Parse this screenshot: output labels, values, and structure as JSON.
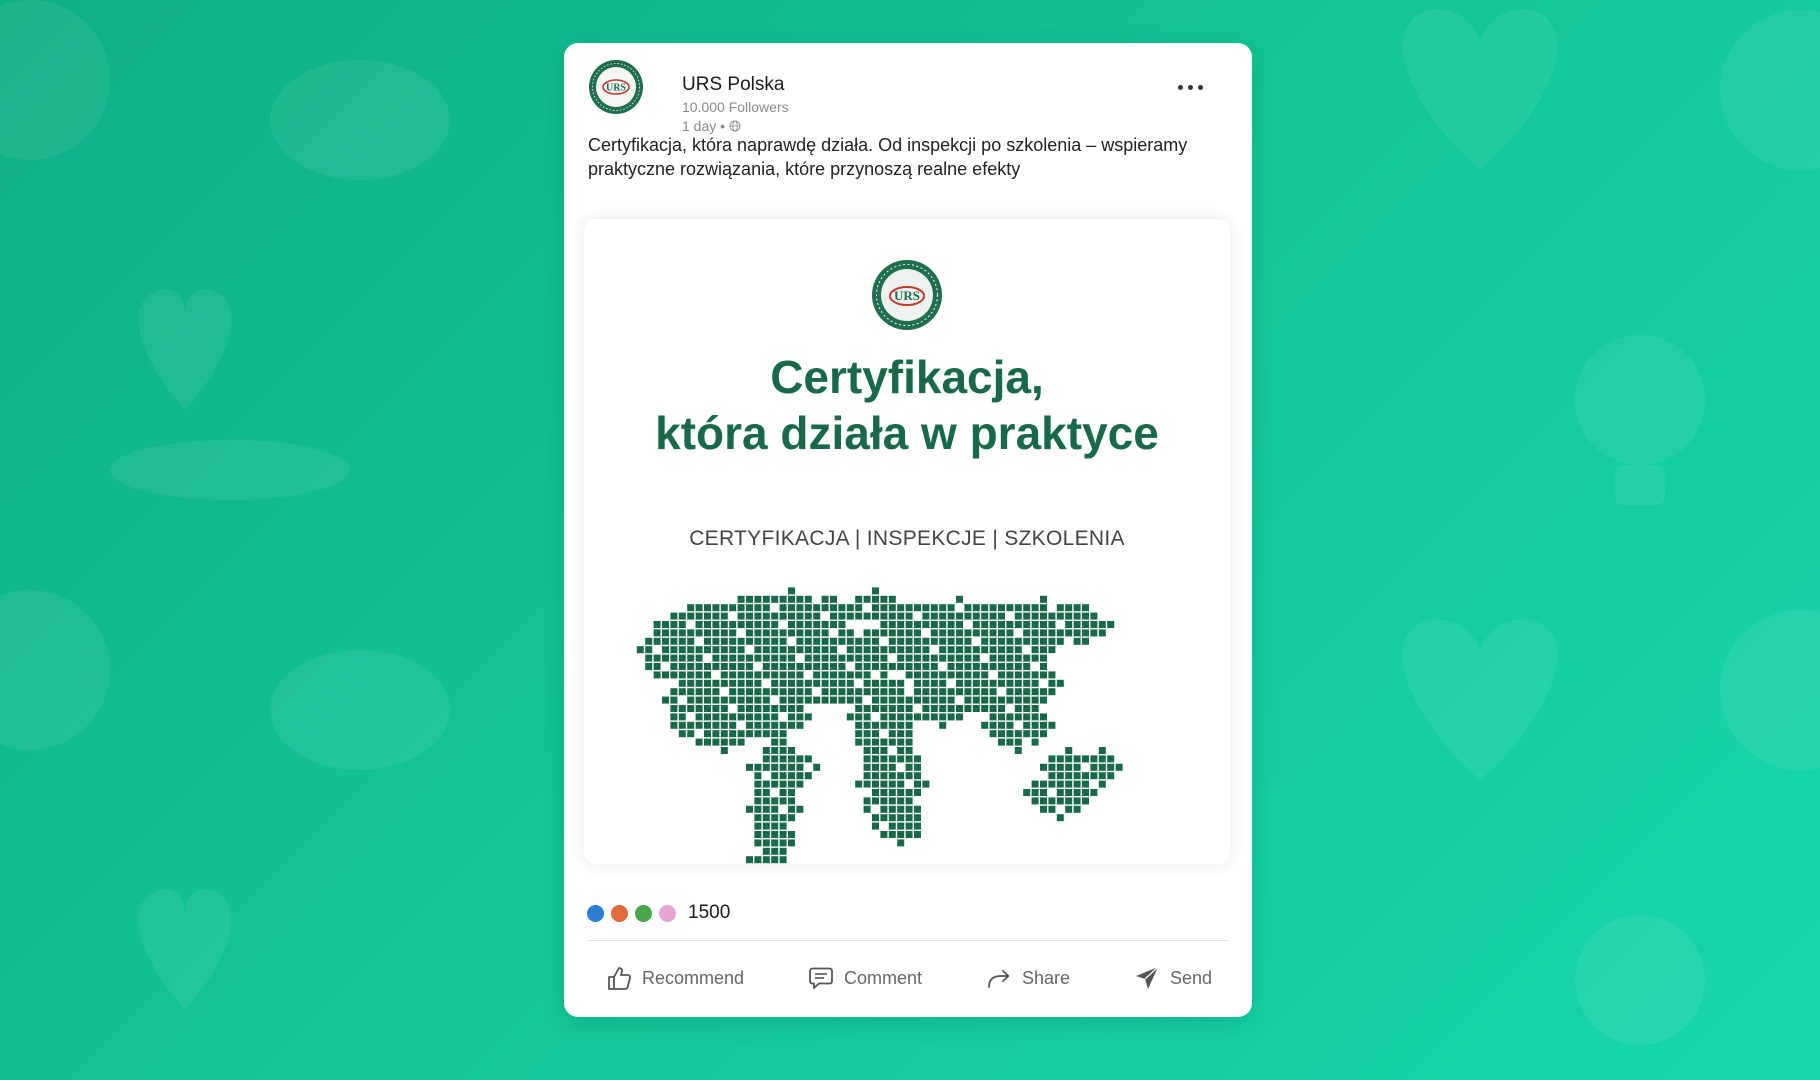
{
  "colors": {
    "background_start": "#0fae84",
    "background_end": "#16d6ad",
    "brand_green": "#17694a",
    "text_dark": "#1b1b1b",
    "text_muted": "#8a8a8a"
  },
  "post": {
    "author": {
      "name": "URS Polska",
      "followers": "10.000 Followers",
      "time": "1 day •",
      "avatar_icon": "urs-logo"
    },
    "more_icon": "more-dots-icon",
    "text": "Certyfikacja, która naprawdę działa. Od inspekcji po szkolenia – wspieramy praktyczne rozwiązania, które przynoszą realne efekty",
    "media": {
      "logo_text": "URS",
      "logo_ring_text": "UNITED REGISTRAR OF SYSTEMS",
      "headline_line1": "Certyfikacja,",
      "headline_line2": "która działa w praktyce",
      "subline": "CERTYFIKACJA | INSPEKCJE | SZKOLENIA",
      "map_color": "#17694a"
    },
    "reactions": {
      "icons": [
        {
          "name": "like-reaction-icon",
          "color": "#2b7cd3"
        },
        {
          "name": "love-reaction-icon",
          "color": "#e06a3b"
        },
        {
          "name": "celebrate-reaction-icon",
          "color": "#4aa64a"
        },
        {
          "name": "insightful-reaction-icon",
          "color": "#e6a6d4"
        }
      ],
      "count": "1500"
    },
    "actions": [
      {
        "label": "Recommend",
        "icon": "thumbs-up-icon"
      },
      {
        "label": "Comment",
        "icon": "comment-icon"
      },
      {
        "label": "Share",
        "icon": "share-arrow-icon"
      },
      {
        "label": "Send",
        "icon": "send-icon"
      }
    ]
  }
}
